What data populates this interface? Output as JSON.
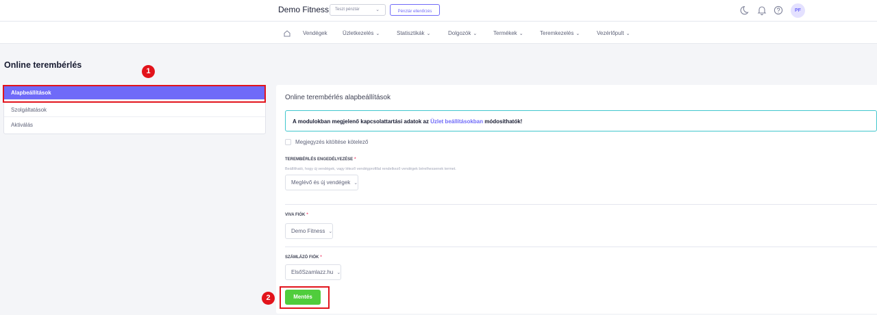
{
  "header": {
    "brand": "Demo Fitness",
    "register_select": "Teszt pénztár",
    "check_register_label": "Pénztár ellenőrzés",
    "avatar_initials": "PF",
    "icons": [
      "moon-icon",
      "bell-icon",
      "help-icon"
    ]
  },
  "nav": {
    "items": [
      {
        "label": "Vendégek",
        "has_dropdown": false
      },
      {
        "label": "Üzletkezelés",
        "has_dropdown": true
      },
      {
        "label": "Statisztikák",
        "has_dropdown": true
      },
      {
        "label": "Dolgozók",
        "has_dropdown": true
      },
      {
        "label": "Termékek",
        "has_dropdown": true
      },
      {
        "label": "Teremkezelés",
        "has_dropdown": true
      },
      {
        "label": "Vezérlőpult",
        "has_dropdown": true
      }
    ]
  },
  "page": {
    "title": "Online terembérlés"
  },
  "sidebar": {
    "items": [
      {
        "label": "Alapbeállítások",
        "active": true
      },
      {
        "label": "Szolgáltatások",
        "active": false
      },
      {
        "label": "Aktiválás",
        "active": false
      }
    ]
  },
  "markers": [
    "1",
    "2"
  ],
  "panel": {
    "title": "Online terembérlés alapbeállítások",
    "info_prefix": "A modulokban megjelenő kapcsolattartási adatok az ",
    "info_link": "Üzlet beállításokban",
    "info_suffix": " módosíthatók!",
    "checkbox_label": "Megjegyzés kitöltése kötelező",
    "rental_label": "TEREMBÉRLÉS ENGEDÉLYEZÉSE",
    "rental_hint": "Beállítható, hogy új vendégek, vagy létező vendégprofillal rendelkező vendégek bérelhessenek termet.",
    "rental_value": "Meglévő és új vendégek",
    "viva_label": "VIVA FIÓK",
    "viva_value": "Demo Fitness",
    "szamlazo_label": "SZÁMLÁZÓ FIÓK",
    "szamlazo_value": "ElsőSzamlazz.hu",
    "required_mark": "*",
    "save_label": "Mentés"
  },
  "colors": {
    "accent": "#6f6af8",
    "save": "#50cd3c",
    "highlight": "#e2131b",
    "info_border": "#3fc6cd"
  }
}
